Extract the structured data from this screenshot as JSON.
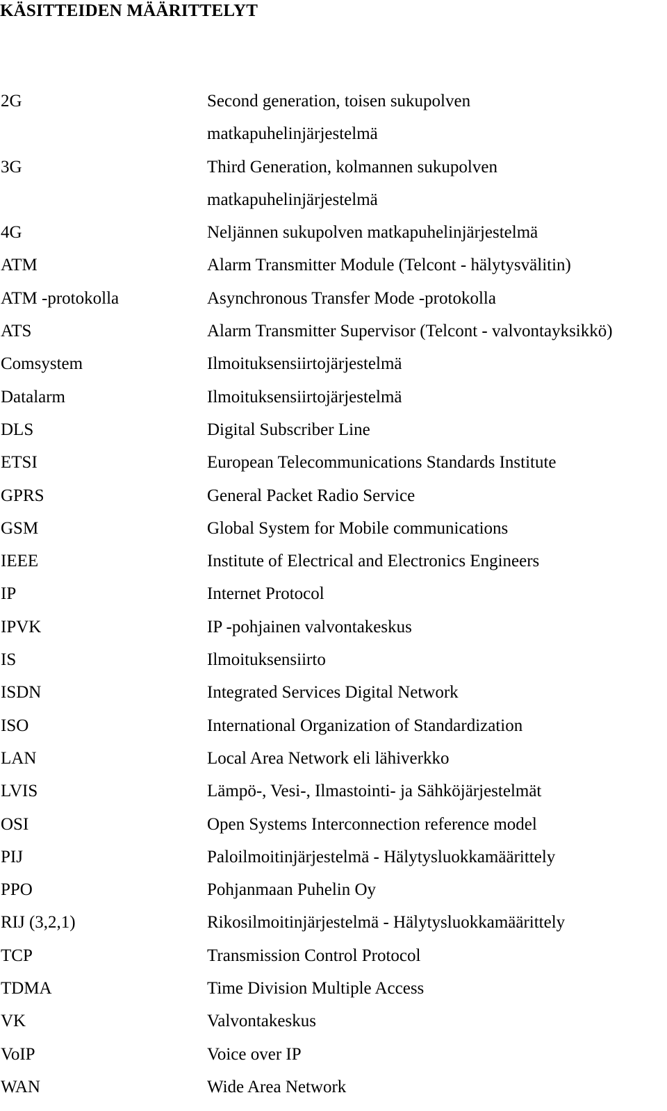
{
  "page": {
    "title": "KÄSITTEIDEN MÄÄRITTELYT"
  },
  "terms": [
    {
      "term": "2G",
      "definition": [
        "Second generation, toisen sukupolven",
        "matkapuhelinjärjestelmä"
      ]
    },
    {
      "term": "3G",
      "definition": [
        "Third Generation, kolmannen sukupolven",
        "matkapuhelinjärjestelmä"
      ]
    },
    {
      "term": "4G",
      "definition": [
        "Neljännen sukupolven matkapuhelinjärjestelmä"
      ]
    },
    {
      "term": "ATM",
      "definition": [
        "Alarm Transmitter Module (Telcont - hälytysvälitin)"
      ]
    },
    {
      "term": "ATM -protokolla",
      "definition": [
        "Asynchronous Transfer Mode -protokolla"
      ]
    },
    {
      "term": "ATS",
      "definition": [
        "Alarm Transmitter Supervisor (Telcont - valvontayksikkö)"
      ]
    },
    {
      "term": "Comsystem",
      "definition": [
        "Ilmoituksensiirtojärjestelmä"
      ]
    },
    {
      "term": "Datalarm",
      "definition": [
        "Ilmoituksensiirtojärjestelmä"
      ]
    },
    {
      "term": "DLS",
      "definition": [
        "Digital Subscriber Line"
      ]
    },
    {
      "term": "ETSI",
      "definition": [
        "European Telecommunications Standards Institute"
      ]
    },
    {
      "term": "GPRS",
      "definition": [
        "General Packet Radio Service"
      ]
    },
    {
      "term": "GSM",
      "definition": [
        "Global System for Mobile communications"
      ]
    },
    {
      "term": "IEEE",
      "definition": [
        "Institute of Electrical and Electronics Engineers"
      ]
    },
    {
      "term": "IP",
      "definition": [
        "Internet Protocol"
      ]
    },
    {
      "term": "IPVK",
      "definition": [
        "IP -pohjainen valvontakeskus"
      ]
    },
    {
      "term": "IS",
      "definition": [
        "Ilmoituksensiirto"
      ]
    },
    {
      "term": "ISDN",
      "definition": [
        "Integrated Services Digital Network"
      ]
    },
    {
      "term": "ISO",
      "definition": [
        "International Organization of Standardization"
      ]
    },
    {
      "term": "LAN",
      "definition": [
        "Local Area Network eli lähiverkko"
      ]
    },
    {
      "term": "LVIS",
      "definition": [
        "Lämpö-, Vesi-, Ilmastointi- ja Sähköjärjestelmät"
      ]
    },
    {
      "term": "OSI",
      "definition": [
        "Open Systems Interconnection reference model"
      ]
    },
    {
      "term": "PIJ",
      "definition": [
        "Paloilmoitinjärjestelmä - Hälytysluokkamäärittely"
      ]
    },
    {
      "term": "PPO",
      "definition": [
        "Pohjanmaan Puhelin Oy"
      ]
    },
    {
      "term": "RIJ (3,2,1)",
      "definition": [
        "Rikosilmoitinjärjestelmä - Hälytysluokkamäärittely"
      ]
    },
    {
      "term": "TCP",
      "definition": [
        "Transmission Control Protocol"
      ]
    },
    {
      "term": "TDMA",
      "definition": [
        "Time Division Multiple Access"
      ]
    },
    {
      "term": "VK",
      "definition": [
        "Valvontakeskus"
      ]
    },
    {
      "term": "VoIP",
      "definition": [
        "Voice over IP"
      ]
    },
    {
      "term": "WAN",
      "definition": [
        "Wide Area Network"
      ]
    }
  ]
}
